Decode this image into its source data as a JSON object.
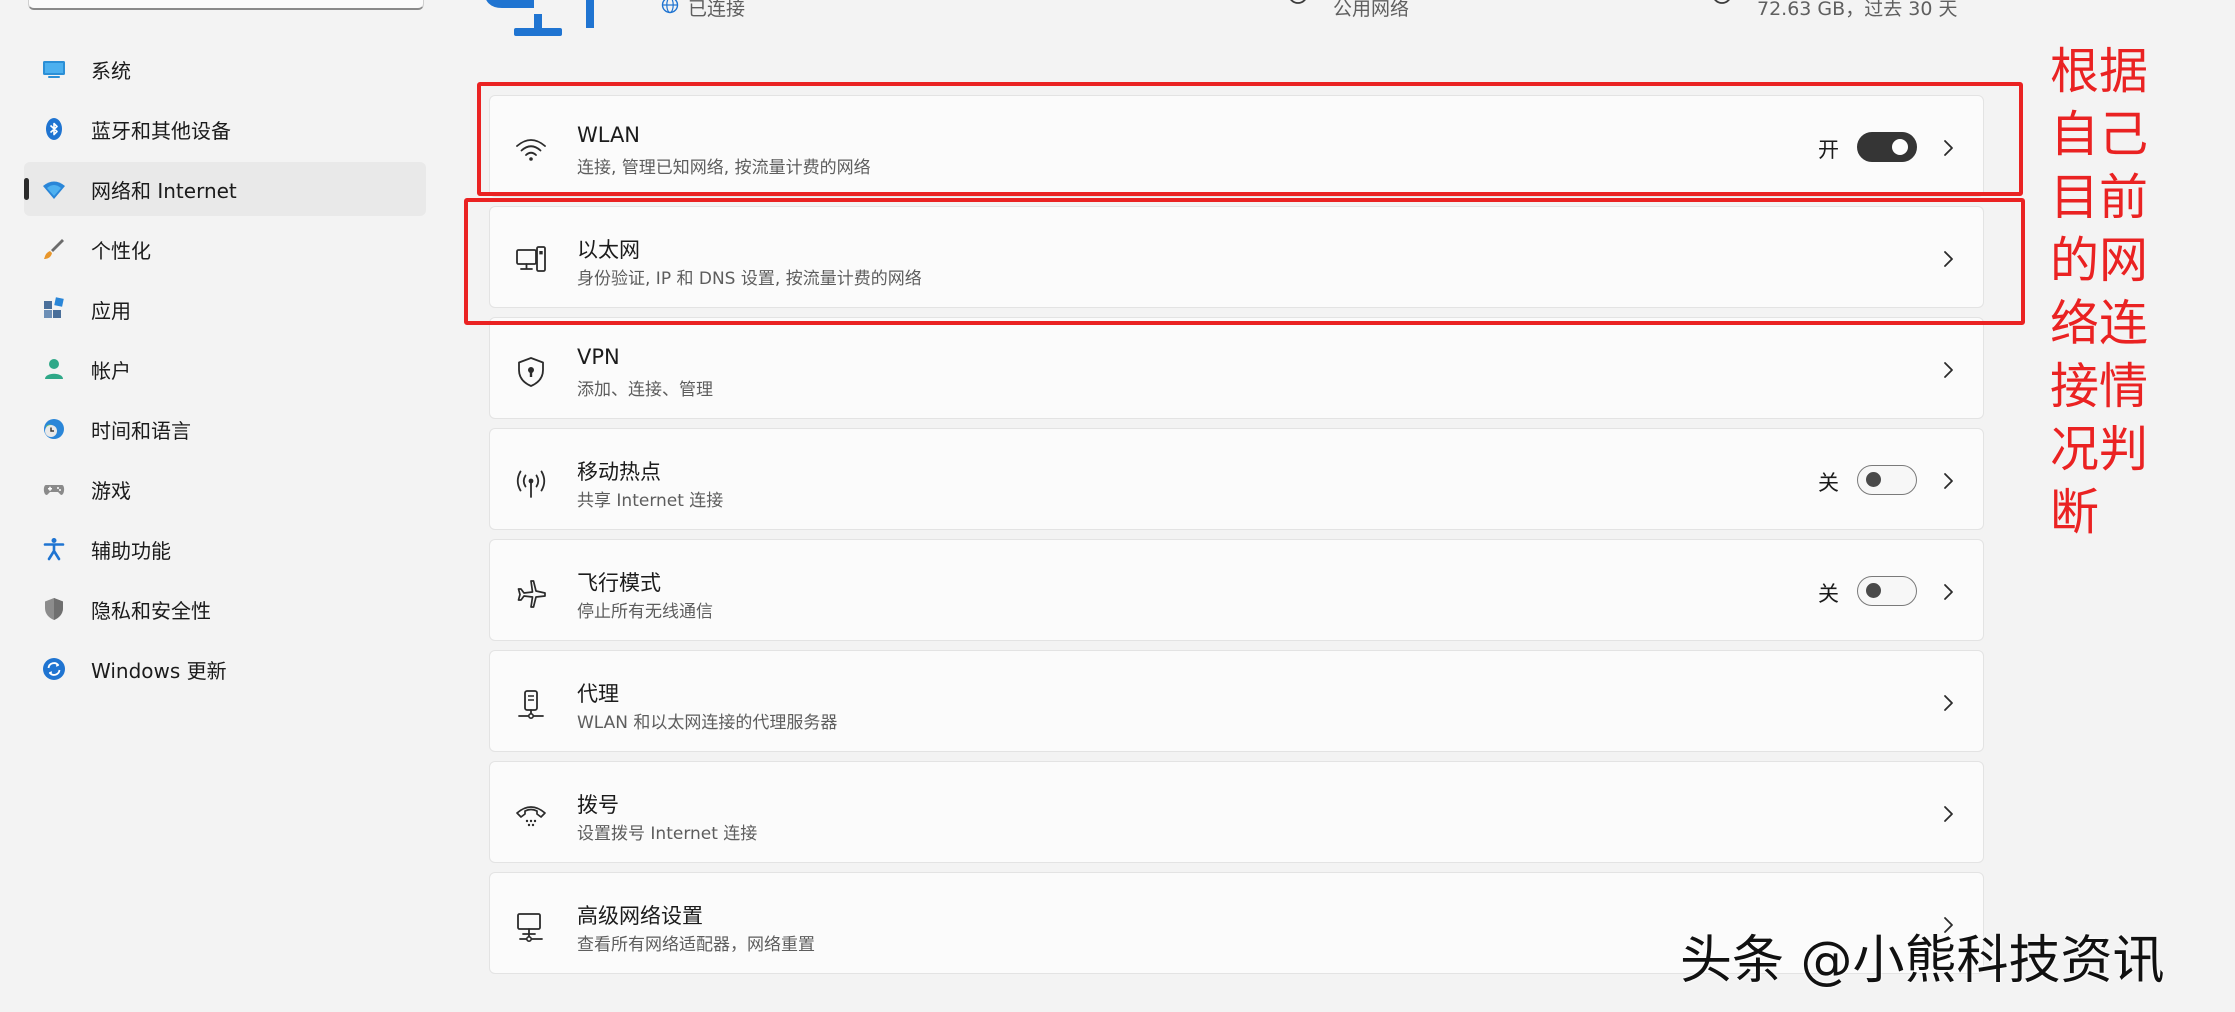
{
  "sidebar": {
    "items": [
      {
        "label": "系统",
        "icon": "display-icon"
      },
      {
        "label": "蓝牙和其他设备",
        "icon": "bluetooth-icon"
      },
      {
        "label": "网络和 Internet",
        "icon": "network-icon",
        "active": true
      },
      {
        "label": "个性化",
        "icon": "brush-icon"
      },
      {
        "label": "应用",
        "icon": "apps-icon"
      },
      {
        "label": "帐户",
        "icon": "person-icon"
      },
      {
        "label": "时间和语言",
        "icon": "clock-globe-icon"
      },
      {
        "label": "游戏",
        "icon": "gamepad-icon"
      },
      {
        "label": "辅助功能",
        "icon": "accessibility-icon"
      },
      {
        "label": "隐私和安全性",
        "icon": "shield-icon"
      },
      {
        "label": "Windows 更新",
        "icon": "update-icon"
      }
    ]
  },
  "status": {
    "connection": "已连接",
    "network_type": "公用网络",
    "data_usage": "72.63 GB，过去 30 天"
  },
  "settings": [
    {
      "title": "WLAN",
      "subtitle": "连接, 管理已知网络, 按流量计费的网络",
      "icon": "wifi-icon",
      "toggle_label": "开",
      "toggle_on": true
    },
    {
      "title": "以太网",
      "subtitle": "身份验证, IP 和 DNS 设置, 按流量计费的网络",
      "icon": "ethernet-icon"
    },
    {
      "title": "VPN",
      "subtitle": "添加、连接、管理",
      "icon": "vpn-shield-icon"
    },
    {
      "title": "移动热点",
      "subtitle": "共享 Internet 连接",
      "icon": "hotspot-icon",
      "toggle_label": "关",
      "toggle_on": false
    },
    {
      "title": "飞行模式",
      "subtitle": "停止所有无线通信",
      "icon": "airplane-icon",
      "toggle_label": "关",
      "toggle_on": false
    },
    {
      "title": "代理",
      "subtitle": "WLAN 和以太网连接的代理服务器",
      "icon": "proxy-icon"
    },
    {
      "title": "拨号",
      "subtitle": "设置拨号 Internet 连接",
      "icon": "dialup-icon"
    },
    {
      "title": "高级网络设置",
      "subtitle": "查看所有网络适配器，网络重置",
      "icon": "advanced-network-icon"
    }
  ],
  "annotation": {
    "note": "根据自己目前的网络连接情况判断",
    "color": "#ea2222"
  },
  "watermark": "头条 @小熊科技资讯",
  "colors": {
    "accent": "#0067c0",
    "toggle_on": "#353535",
    "background": "#f3f3f3"
  }
}
